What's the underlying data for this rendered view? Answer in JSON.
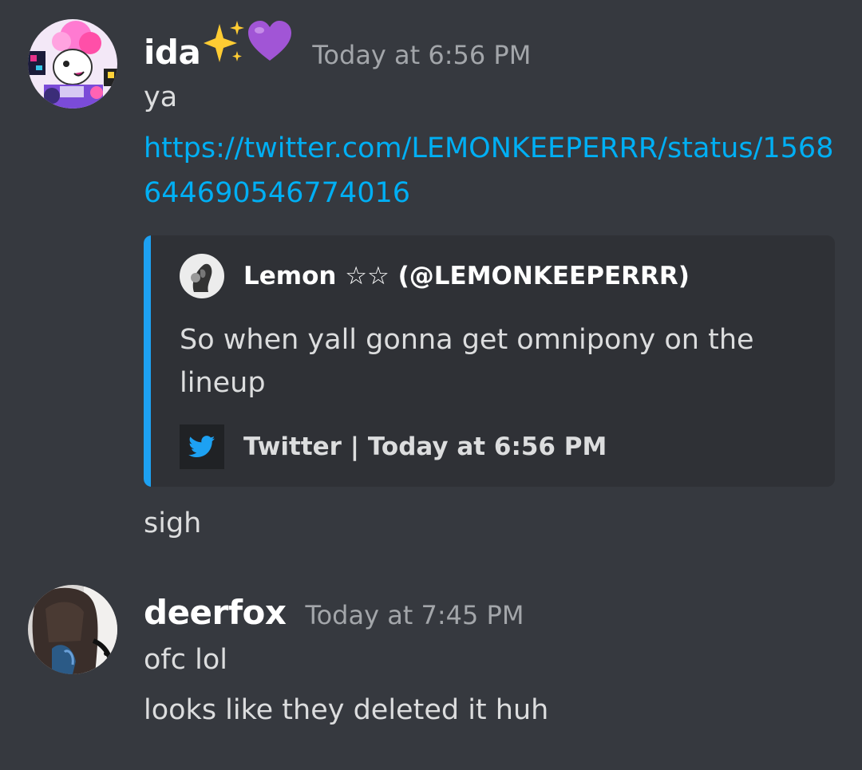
{
  "messages": [
    {
      "username": "ida",
      "emojis": [
        "sparkles",
        "purple-heart"
      ],
      "timestamp": "Today at 6:56 PM",
      "lines": [
        "ya"
      ],
      "link": "https://twitter.com/LEMONKEEPERRR/status/1568644690546774016",
      "embed": {
        "accent_color": "#1da1f2",
        "author": "Lemon ☆☆ (@LEMONKEEPERRR)",
        "description": "So when yall gonna get omnipony on the lineup",
        "footer": "Twitter | Today at 6:56 PM",
        "footer_icon": "twitter-bird-icon"
      },
      "after_embed": "sigh"
    },
    {
      "username": "deerfox",
      "timestamp": "Today at 7:45 PM",
      "lines": [
        "ofc lol",
        "looks like they deleted it huh"
      ]
    }
  ],
  "colors": {
    "background": "#36393f",
    "embed_background": "#2f3136",
    "link": "#00aff4",
    "username": "#ffffff",
    "timestamp": "#a3a6aa"
  }
}
